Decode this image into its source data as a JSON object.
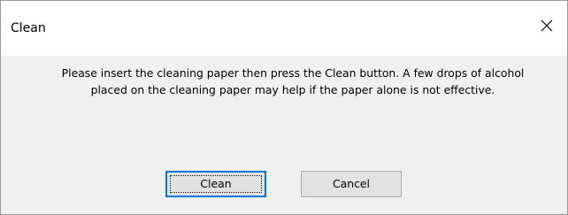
{
  "dialog": {
    "title": "Clean",
    "message": "Please insert the cleaning paper then press the Clean button. A few drops of alcohol placed on the cleaning paper may help if the paper alone is not effective.",
    "close_icon": "close-icon"
  },
  "buttons": {
    "clean_label": "Clean",
    "cancel_label": "Cancel"
  },
  "colors": {
    "focus_border": "#0078d7",
    "button_face": "#e1e1e1",
    "dialog_body": "#f0f0f0"
  }
}
